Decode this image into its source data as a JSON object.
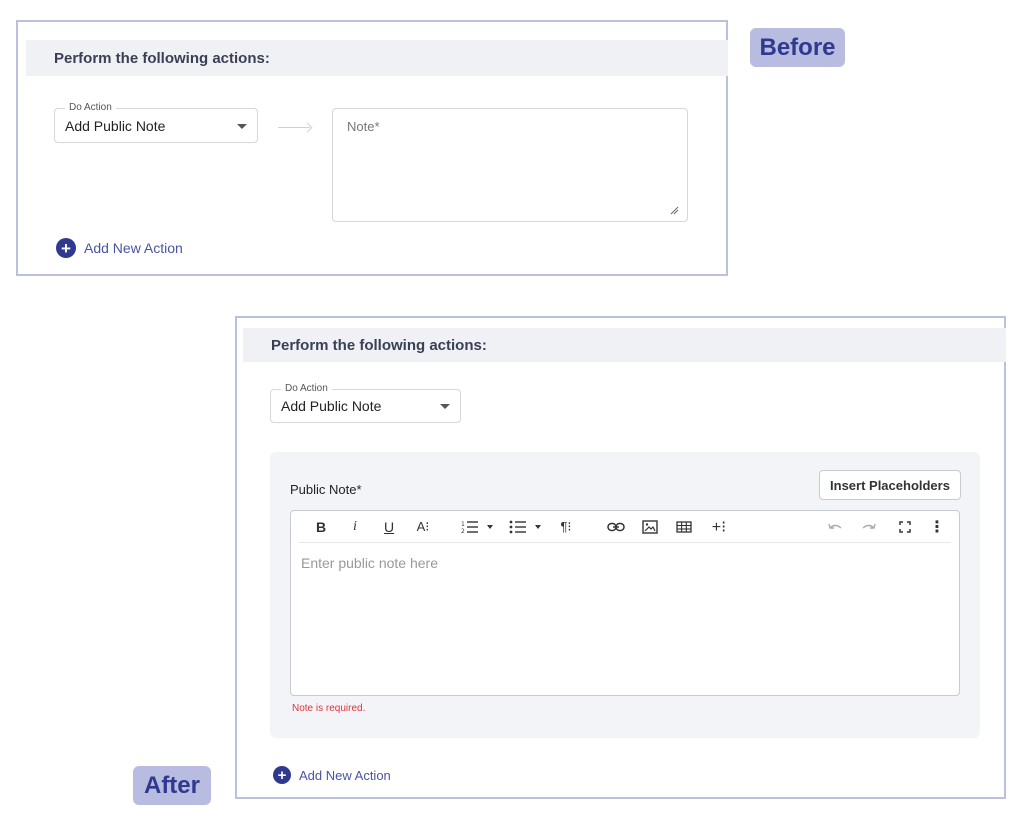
{
  "before": {
    "tag": "Before",
    "header": "Perform the following actions:",
    "do_action": {
      "label": "Do Action",
      "value": "Add Public Note"
    },
    "note_placeholder": "Note*",
    "add_new_action": "Add New Action"
  },
  "after": {
    "tag": "After",
    "header": "Perform the following actions:",
    "do_action": {
      "label": "Do Action",
      "value": "Add Public Note"
    },
    "editor": {
      "title": "Public Note*",
      "insert_placeholders": "Insert Placeholders",
      "placeholder": "Enter public note here",
      "error": "Note is required.",
      "toolbar": [
        "bold-icon",
        "italic-icon",
        "underline-icon",
        "font-size-icon",
        "ordered-list-icon",
        "ordered-list-dropdown-icon",
        "unordered-list-icon",
        "unordered-list-dropdown-icon",
        "paragraph-format-icon",
        "link-icon",
        "image-icon",
        "table-icon",
        "insert-more-icon",
        "undo-icon",
        "redo-icon",
        "fullscreen-icon",
        "more-options-icon"
      ]
    },
    "add_new_action": "Add New Action"
  },
  "colors": {
    "accent": "#2f3a8f",
    "accent_link": "#4a54a3",
    "tag_bg": "#b8bce0",
    "panel_border": "#bcc0df",
    "header_bg": "#f0f1f5",
    "error": "#e0343b"
  }
}
